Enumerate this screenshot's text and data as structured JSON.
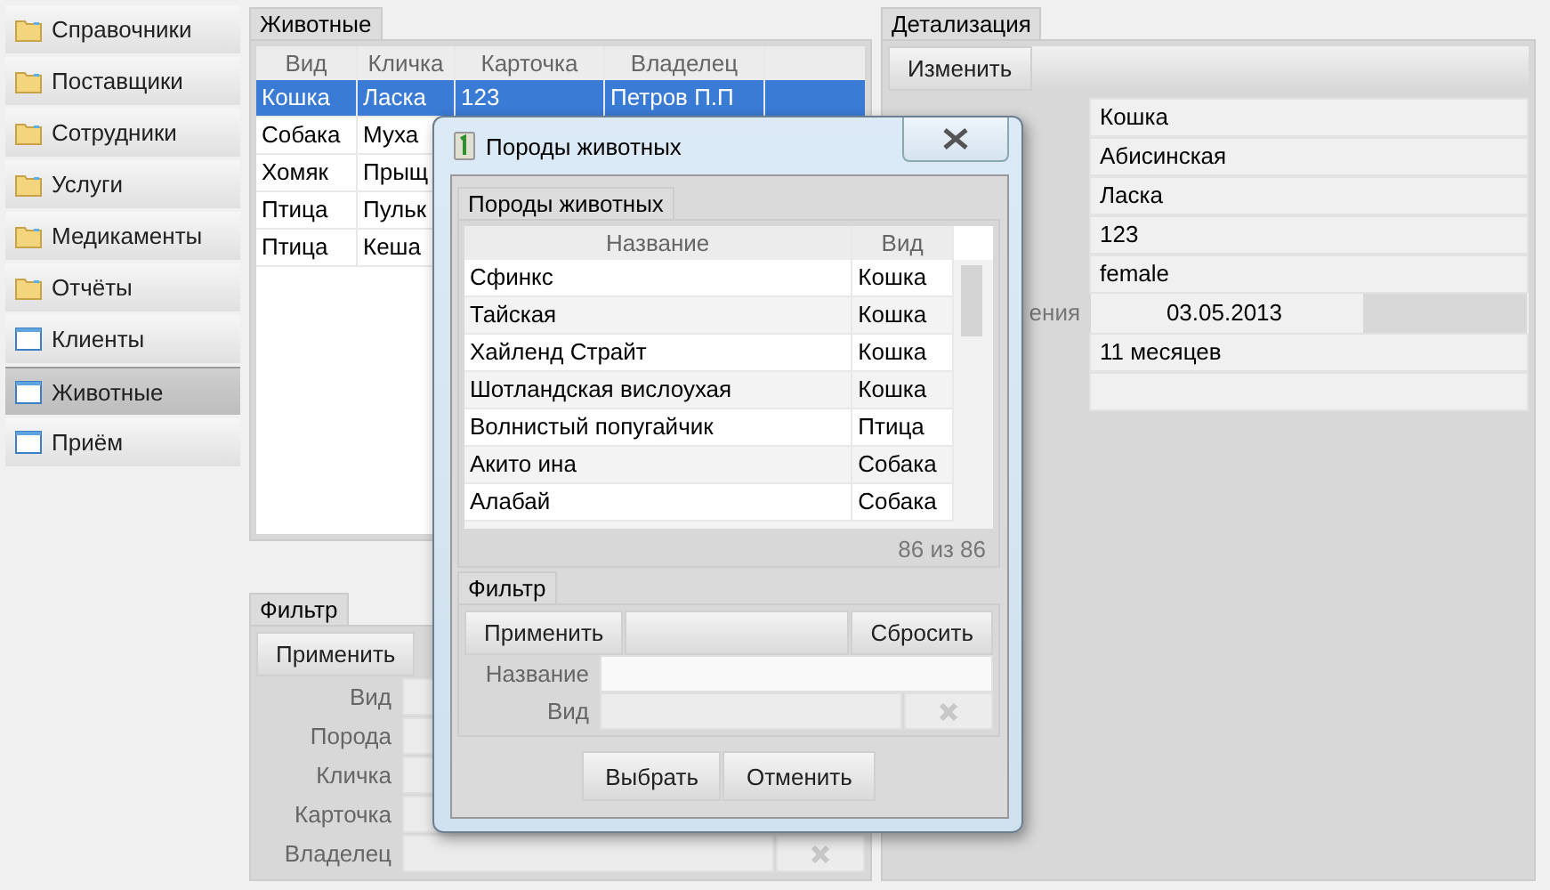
{
  "sidebar": {
    "items": [
      {
        "label": "Справочники",
        "kind": "folder",
        "selected": false
      },
      {
        "label": "Поставщики",
        "kind": "folder",
        "selected": false
      },
      {
        "label": "Сотрудники",
        "kind": "folder",
        "selected": false
      },
      {
        "label": "Услуги",
        "kind": "folder",
        "selected": false
      },
      {
        "label": "Медикаменты",
        "kind": "folder",
        "selected": false
      },
      {
        "label": "Отчёты",
        "kind": "folder",
        "selected": false
      },
      {
        "label": "Клиенты",
        "kind": "window",
        "selected": false
      },
      {
        "label": "Животные",
        "kind": "window",
        "selected": true
      },
      {
        "label": "Приём",
        "kind": "window",
        "selected": false
      }
    ]
  },
  "animals": {
    "tab": "Животные",
    "columns": [
      "Вид",
      "Кличка",
      "Карточка",
      "Владелец"
    ],
    "rows": [
      {
        "cells": [
          "Кошка",
          "Ласка",
          "123",
          "Петров П.П"
        ],
        "selected": true
      },
      {
        "cells": [
          "Собака",
          "Муха"
        ],
        "selected": false
      },
      {
        "cells": [
          "Хомяк",
          "Прыщ"
        ],
        "selected": false
      },
      {
        "cells": [
          "Птица",
          "Пульк"
        ],
        "selected": false
      },
      {
        "cells": [
          "Птица",
          "Кеша"
        ],
        "selected": false
      }
    ]
  },
  "animals_filter": {
    "tab": "Фильтр",
    "apply": "Применить",
    "fields": [
      {
        "label": "Вид",
        "kind": "text"
      },
      {
        "label": "Порода",
        "kind": "text"
      },
      {
        "label": "Кличка",
        "kind": "text"
      },
      {
        "label": "Карточка",
        "kind": "text"
      },
      {
        "label": "Владелец",
        "kind": "combo"
      }
    ]
  },
  "details": {
    "tab": "Детализация",
    "edit": "Изменить",
    "fields": [
      {
        "value": "Кошка",
        "kind": "wide"
      },
      {
        "value": "Абисинская",
        "kind": "wide"
      },
      {
        "value": "Ласка",
        "kind": "wide"
      },
      {
        "value": "123",
        "kind": "wide"
      },
      {
        "value": "female",
        "kind": "wide"
      },
      {
        "label": "ения",
        "value": "03.05.2013",
        "kind": "date"
      },
      {
        "value": "11 месяцев",
        "kind": "wide"
      },
      {
        "kind": "wide"
      }
    ]
  },
  "dialog": {
    "title": "Породы животных",
    "breeds": {
      "tab": "Породы животных",
      "columns": [
        "Название",
        "Вид"
      ],
      "rows": [
        [
          "Сфинкс",
          "Кошка"
        ],
        [
          "Тайская",
          "Кошка"
        ],
        [
          "Хайленд Страйт",
          "Кошка"
        ],
        [
          "Шотландская вислоухая",
          "Кошка"
        ],
        [
          "Волнистый попугайчик",
          "Птица"
        ],
        [
          "Акито ина",
          "Собака"
        ],
        [
          "Алабай",
          "Собака"
        ]
      ],
      "count": "86 из 86"
    },
    "filter": {
      "tab": "Фильтр",
      "apply": "Применить",
      "reset": "Сбросить",
      "fields": [
        {
          "label": "Название",
          "kind": "text"
        },
        {
          "label": "Вид",
          "kind": "combo"
        }
      ]
    },
    "buttons": [
      "Выбрать",
      "Отменить"
    ]
  }
}
